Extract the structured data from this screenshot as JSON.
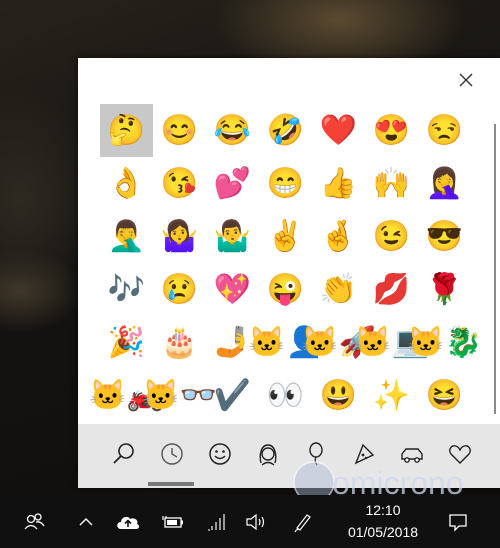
{
  "emoji_panel": {
    "close_label": "✕",
    "emojis": [
      {
        "char": "🤔",
        "selected": true
      },
      {
        "char": "😊"
      },
      {
        "char": "😂"
      },
      {
        "char": "🤣"
      },
      {
        "char": "❤️"
      },
      {
        "char": "😍"
      },
      {
        "char": "😒"
      },
      {
        "char": "👌"
      },
      {
        "char": "😘"
      },
      {
        "char": "💕"
      },
      {
        "char": "😁"
      },
      {
        "char": "👍"
      },
      {
        "char": "🙌"
      },
      {
        "char": "🤦‍♀️"
      },
      {
        "char": "🤦‍♂️"
      },
      {
        "char": "🤷‍♀️"
      },
      {
        "char": "🤷‍♂️"
      },
      {
        "char": "✌️"
      },
      {
        "char": "🤞"
      },
      {
        "char": "😉"
      },
      {
        "char": "😎"
      },
      {
        "char": "🎶"
      },
      {
        "char": "😢"
      },
      {
        "char": "💖"
      },
      {
        "char": "😜"
      },
      {
        "char": "👏"
      },
      {
        "char": "💋"
      },
      {
        "char": "🌹"
      },
      {
        "char": "🎉"
      },
      {
        "char": "🎂"
      },
      {
        "char": "🤳"
      },
      {
        "char": "🐱‍👤"
      },
      {
        "char": "🐱‍🚀"
      },
      {
        "char": "🐱‍💻"
      },
      {
        "char": "🐱‍🐉"
      },
      {
        "char": "🐱‍🏍"
      },
      {
        "char": "🐱‍👓"
      },
      {
        "char": "✔️"
      },
      {
        "char": "👀"
      },
      {
        "char": "😃"
      },
      {
        "char": "✨"
      },
      {
        "char": "😆"
      }
    ],
    "categories": [
      {
        "name": "search-category-icon"
      },
      {
        "name": "recent-category-icon",
        "active": true
      },
      {
        "name": "smiley-category-icon"
      },
      {
        "name": "people-category-icon"
      },
      {
        "name": "celebration-category-icon"
      },
      {
        "name": "food-category-icon"
      },
      {
        "name": "transport-category-icon"
      },
      {
        "name": "symbols-category-icon"
      }
    ]
  },
  "watermark": {
    "text": "omicrono"
  },
  "taskbar": {
    "time": "12:10",
    "date": "01/05/2018",
    "icons": [
      "people-icon",
      "chevron-up-icon",
      "cloud-upload-icon",
      "battery-plug-icon",
      "wifi-icon",
      "volume-icon",
      "pen-icon",
      "notifications-icon"
    ]
  }
}
